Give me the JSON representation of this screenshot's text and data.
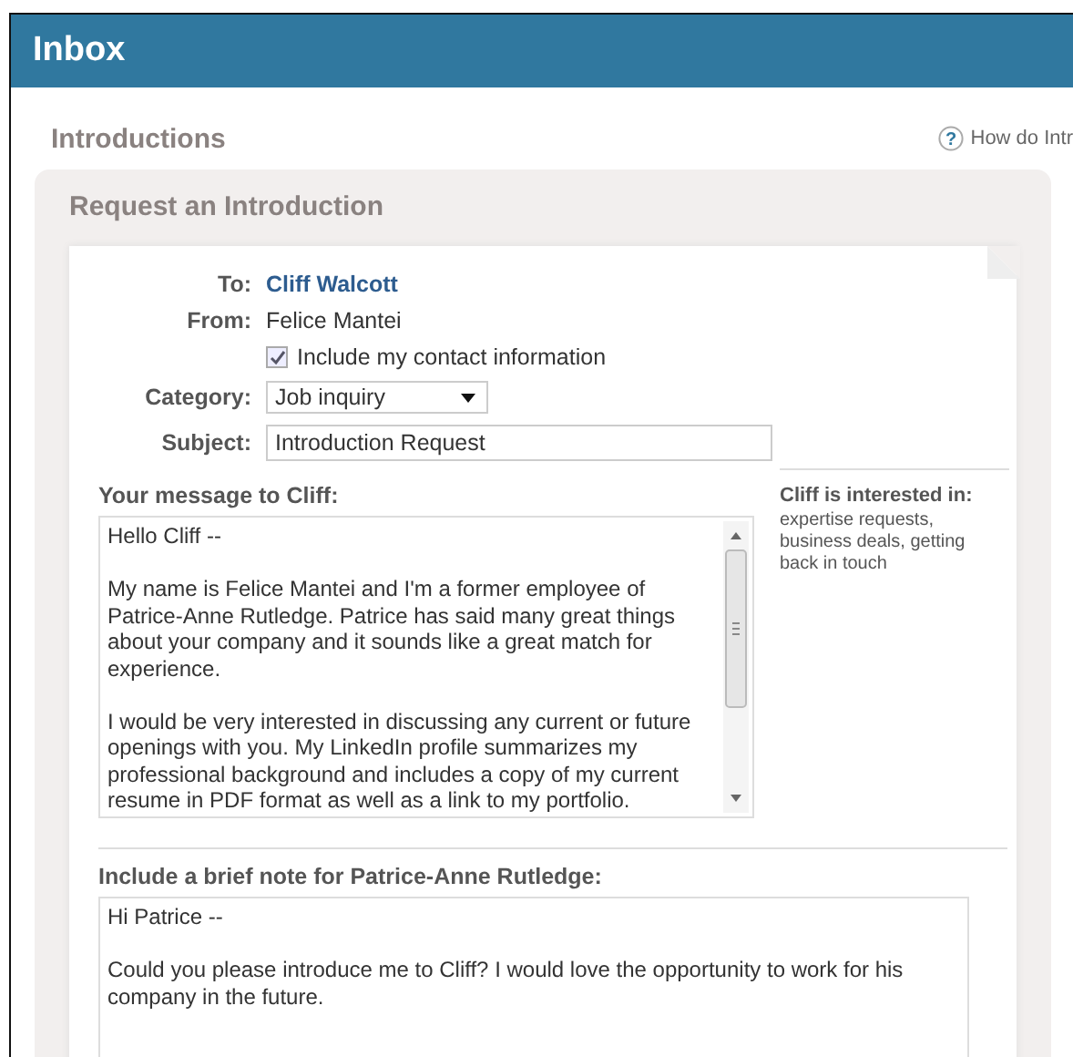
{
  "header": {
    "title": "Inbox"
  },
  "section": {
    "title": "Introductions",
    "help_icon": "?",
    "help_link": "How do Intr"
  },
  "card": {
    "title": "Request an Introduction"
  },
  "form": {
    "to_label": "To:",
    "to_value": "Cliff Walcott",
    "from_label": "From:",
    "from_value": "Felice Mantei",
    "include_contact": {
      "label": "Include my contact information",
      "checked": true
    },
    "category_label": "Category:",
    "category_value": "Job inquiry",
    "subject_label": "Subject:",
    "subject_value": "Introduction Request"
  },
  "message": {
    "label": "Your message to Cliff:",
    "paragraphs": [
      "Hello Cliff --",
      "My name is Felice Mantei and I'm a former employee of\nPatrice-Anne Rutledge. Patrice has said many great things\nabout your company and it sounds like a great match for\nexperience.",
      "I would be very interested in discussing any current or future\nopenings with you. My LinkedIn profile summarizes my\nprofessional background and includes a copy of my current\nresume in PDF format as well as a link to my portfolio."
    ]
  },
  "interests": {
    "title": "Cliff is interested in:",
    "text": "expertise requests,\nbusiness deals, getting\nback in touch"
  },
  "note": {
    "label": "Include a brief note for Patrice-Anne Rutledge:",
    "paragraphs": [
      "Hi Patrice --",
      "Could you please introduce me to Cliff? I would love the opportunity to work for his\ncompany in the future."
    ]
  }
}
